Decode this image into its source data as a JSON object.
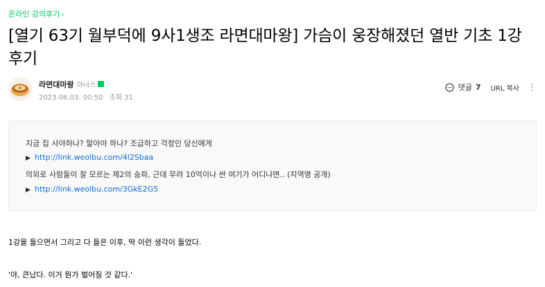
{
  "breadcrumb": {
    "label": "온라인 강의후기"
  },
  "post": {
    "title": "[열기 63기 월부덕에 9사1생조 라면대마왕] 가슴이 웅장해졌던 열반 기초 1강 후기"
  },
  "author": {
    "name": "라면대마왕",
    "grade": "아너스",
    "date": "2023.06.03. 00:50",
    "views_label": "조회",
    "views": "31"
  },
  "actions": {
    "comment_label": "댓글",
    "comment_count": "7",
    "url_copy_label": "URL 복사"
  },
  "notice": {
    "line1": "지금 집 사야하나? 말아야 하나? 조급하고 걱정인 당신에게",
    "link1": "http://link.weolbu.com/4l2Sbaa",
    "line2": "의외로 사람들이 잘 모르는 제2의 송파, 근데 무려 10억이나 싼 여기가 어디냐면.. (지역명 공개)",
    "link2": "http://link.weolbu.com/3GkE2G5"
  },
  "content": {
    "para1": "1강을 들으면서 그리고 다 들은 이후, 딱 이런 생각이 들었다.",
    "para2": "'야, 큰났다. 이거 뭔가 벌어질 것 같다.'"
  }
}
